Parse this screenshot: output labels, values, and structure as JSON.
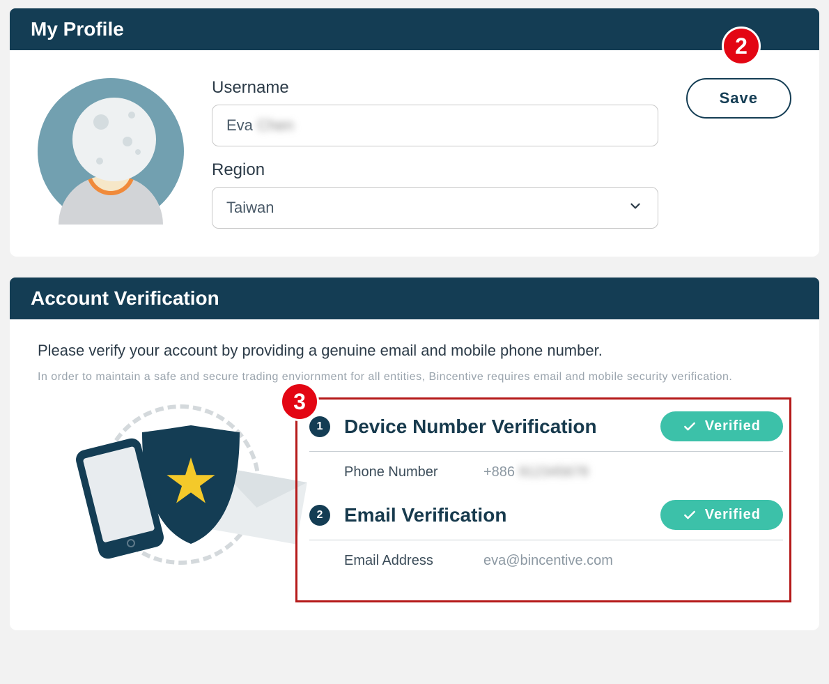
{
  "annotations": {
    "badge2": "2",
    "badge3": "3"
  },
  "profile": {
    "header": "My Profile",
    "username_label": "Username",
    "username_value_visible": "Eva",
    "username_value_hidden": "Chen",
    "region_label": "Region",
    "region_value": "Taiwan",
    "save_label": "Save"
  },
  "verification": {
    "header": "Account Verification",
    "intro": "Please verify your account by providing a genuine email and mobile phone number.",
    "sub": "In order to maintain a safe and secure trading enviornment for all entities, Bincentive requires email and mobile security verification.",
    "sections": [
      {
        "num": "1",
        "title": "Device Number Verification",
        "status": "Verified",
        "field_label": "Phone Number",
        "field_prefix": "+886",
        "field_hidden": "912345678"
      },
      {
        "num": "2",
        "title": "Email Verification",
        "status": "Verified",
        "field_label": "Email Address",
        "field_value": "eva@bincentive.com"
      }
    ]
  }
}
